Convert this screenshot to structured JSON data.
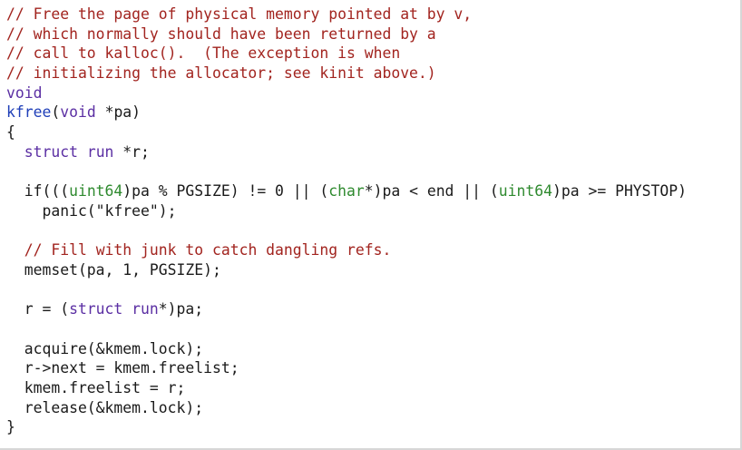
{
  "editor": {
    "lines": [
      [
        {
          "t": "// Free the page of physical memory pointed at by v,",
          "c": "comment"
        }
      ],
      [
        {
          "t": "// which normally should have been returned by a",
          "c": "comment"
        }
      ],
      [
        {
          "t": "// call to kalloc().  (The exception is when",
          "c": "comment"
        }
      ],
      [
        {
          "t": "// initializing the allocator; see kinit above.)",
          "c": "comment"
        }
      ],
      [
        {
          "t": "void",
          "c": "kw"
        }
      ],
      [
        {
          "t": "kfree",
          "c": "fn"
        },
        {
          "t": "(",
          "c": "plain"
        },
        {
          "t": "void",
          "c": "kw"
        },
        {
          "t": " *pa)",
          "c": "plain"
        }
      ],
      [
        {
          "t": "{",
          "c": "plain"
        }
      ],
      [
        {
          "t": "  ",
          "c": "plain"
        },
        {
          "t": "struct run",
          "c": "kw"
        },
        {
          "t": " *r;",
          "c": "plain"
        }
      ],
      [
        {
          "t": "",
          "c": "plain"
        }
      ],
      [
        {
          "t": "  if(((",
          "c": "plain"
        },
        {
          "t": "uint64",
          "c": "type"
        },
        {
          "t": ")pa % PGSIZE) != 0 || (",
          "c": "plain"
        },
        {
          "t": "char",
          "c": "type"
        },
        {
          "t": "*)pa < end || (",
          "c": "plain"
        },
        {
          "t": "uint64",
          "c": "type"
        },
        {
          "t": ")pa >= PHYSTOP)",
          "c": "plain"
        }
      ],
      [
        {
          "t": "    panic(\"kfree\");",
          "c": "plain"
        }
      ],
      [
        {
          "t": "",
          "c": "plain"
        }
      ],
      [
        {
          "t": "  ",
          "c": "plain"
        },
        {
          "t": "// Fill with junk to catch dangling refs.",
          "c": "comment"
        }
      ],
      [
        {
          "t": "  memset(pa, 1, PGSIZE);",
          "c": "plain"
        }
      ],
      [
        {
          "t": "",
          "c": "plain"
        }
      ],
      [
        {
          "t": "  r = (",
          "c": "plain"
        },
        {
          "t": "struct run",
          "c": "kw"
        },
        {
          "t": "*)pa;",
          "c": "plain"
        }
      ],
      [
        {
          "t": "",
          "c": "plain"
        }
      ],
      [
        {
          "t": "  acquire(&kmem.lock);",
          "c": "plain"
        }
      ],
      [
        {
          "t": "  r->next = kmem.freelist;",
          "c": "plain"
        }
      ],
      [
        {
          "t": "  kmem.freelist = r;",
          "c": "plain"
        }
      ],
      [
        {
          "t": "  release(&kmem.lock);",
          "c": "plain"
        }
      ],
      [
        {
          "t": "}",
          "c": "plain"
        }
      ]
    ]
  }
}
